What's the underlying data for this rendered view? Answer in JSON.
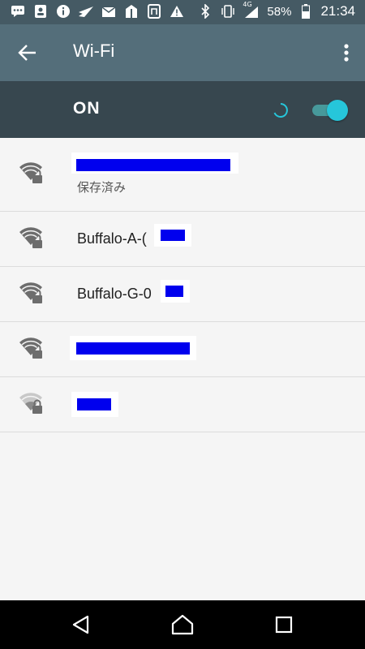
{
  "status_bar": {
    "battery_percent": "58%",
    "time": "21:34",
    "network_type": "4G",
    "left_icons": [
      "message-icon",
      "contact-card-icon",
      "info-icon",
      "send-icon",
      "mail-icon",
      "package-icon",
      "nfc-icon",
      "warning-icon"
    ],
    "right_icons": [
      "bluetooth-icon",
      "vibrate-icon",
      "signal-icon",
      "battery-icon"
    ]
  },
  "app_bar": {
    "title": "Wi-Fi",
    "back_icon": "back-arrow-icon",
    "menu_icon": "more-vert-icon"
  },
  "master_switch": {
    "label": "ON",
    "state": true,
    "accent_color": "#26c6da"
  },
  "networks": [
    {
      "name": "",
      "subtitle": "保存済み",
      "signal": "strong",
      "secured": true
    },
    {
      "name": "Buffalo-A-(",
      "subtitle": "",
      "signal": "strong",
      "secured": true
    },
    {
      "name": "Buffalo-G-0",
      "subtitle": "",
      "signal": "strong",
      "secured": true
    },
    {
      "name": "",
      "subtitle": "",
      "signal": "strong",
      "secured": true
    },
    {
      "name": "",
      "subtitle": "",
      "signal": "weak",
      "secured": true
    }
  ],
  "nav_bar": {
    "icons": [
      "back-triangle-icon",
      "home-icon",
      "recents-icon"
    ]
  },
  "colors": {
    "status_bar": "#455a64",
    "app_bar": "#546e7a",
    "switch_bar": "#37474f",
    "redaction": "#0000ee"
  }
}
